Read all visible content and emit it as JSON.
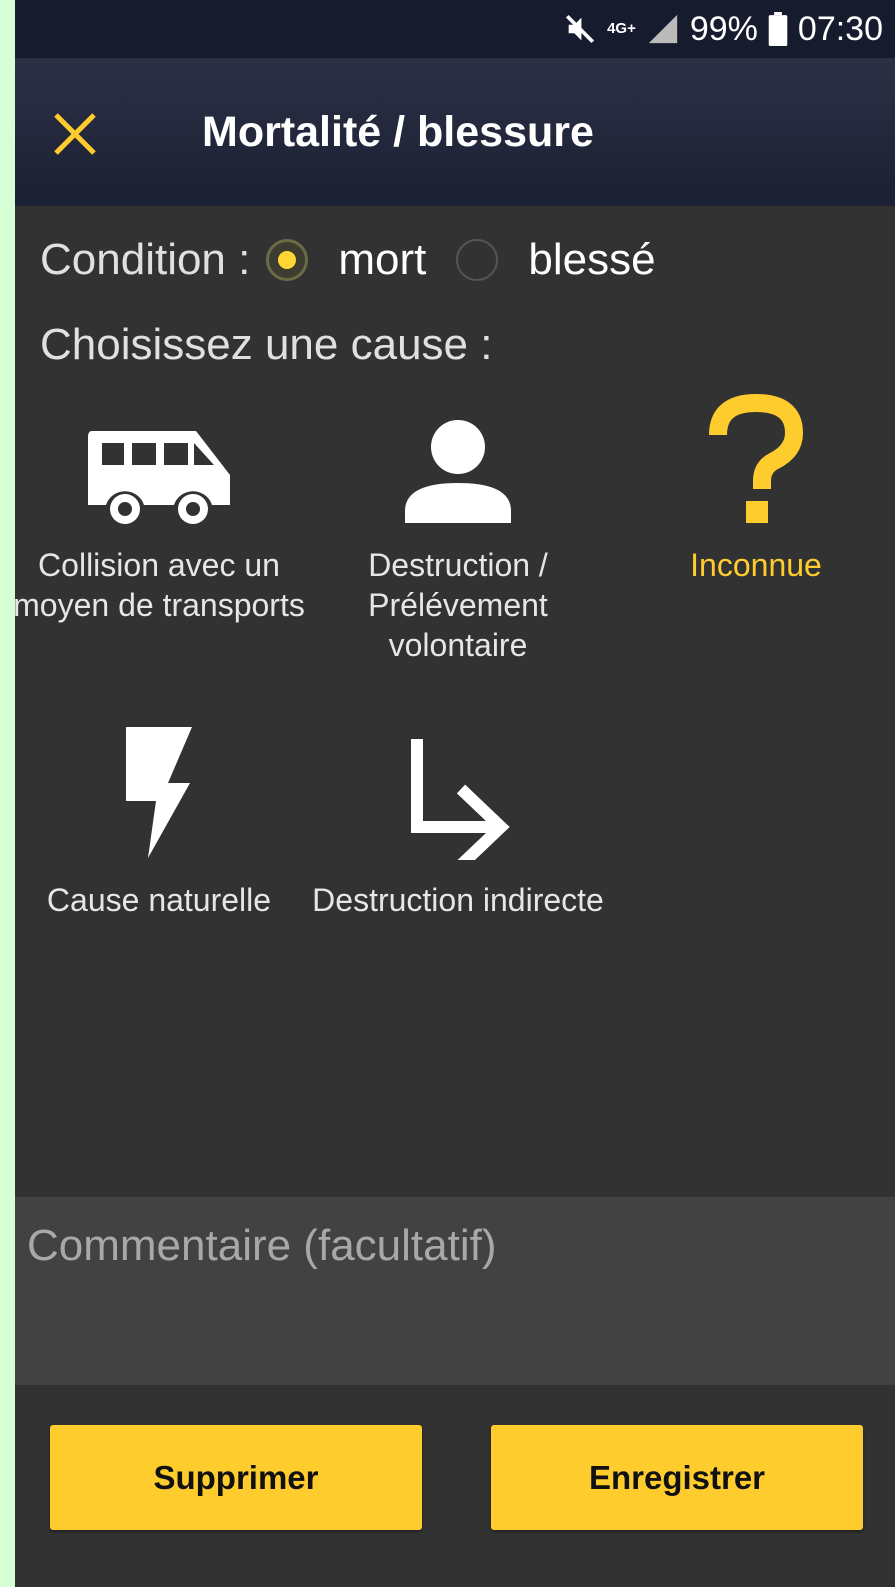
{
  "status_bar": {
    "network": "4G+",
    "battery": "99%",
    "time": "07:30"
  },
  "app_bar": {
    "title": "Mortalité / blessure",
    "close_icon": "close-icon"
  },
  "condition": {
    "label": "Condition :",
    "options": [
      {
        "label": "mort",
        "checked": true
      },
      {
        "label": "blessé",
        "checked": false
      }
    ]
  },
  "cause_prompt": "Choisissez une cause :",
  "causes": [
    {
      "label": "Collision avec un moyen de transports",
      "icon": "van-icon",
      "selected": false
    },
    {
      "label": "Destruction / Prélévement volontaire",
      "icon": "person-icon",
      "selected": false
    },
    {
      "label": "Inconnue",
      "icon": "question-mark-icon",
      "selected": true
    },
    {
      "label": "Cause naturelle",
      "icon": "lightning-icon",
      "selected": false
    },
    {
      "label": "Destruction indirecte",
      "icon": "turn-right-arrow-icon",
      "selected": false
    }
  ],
  "comment": {
    "placeholder": "Commentaire (facultatif)",
    "value": ""
  },
  "buttons": {
    "delete": "Supprimer",
    "save": "Enregistrer"
  },
  "colors": {
    "accent": "#ffcc2e",
    "background": "#323232",
    "app_bar": "#1c2033"
  }
}
